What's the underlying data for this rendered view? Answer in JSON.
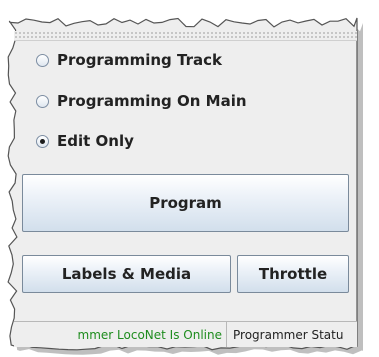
{
  "mode_options": [
    {
      "label": "Programming Track",
      "selected": false
    },
    {
      "label": "Programming On Main",
      "selected": false
    },
    {
      "label": "Edit Only",
      "selected": true
    }
  ],
  "buttons": {
    "program_label": "Program",
    "labels_media_label": "Labels & Media",
    "throttle_label": "Throttle"
  },
  "status_bar": {
    "connection_text": "mmer LocoNet Is Online",
    "connection_color": "#1e8c1e",
    "programmer_status_text": "Programmer Statu"
  },
  "colors": {
    "panel_bg": "#eeeeee",
    "button_border": "#7a8a9b",
    "shadow": "#8a8a8a"
  }
}
